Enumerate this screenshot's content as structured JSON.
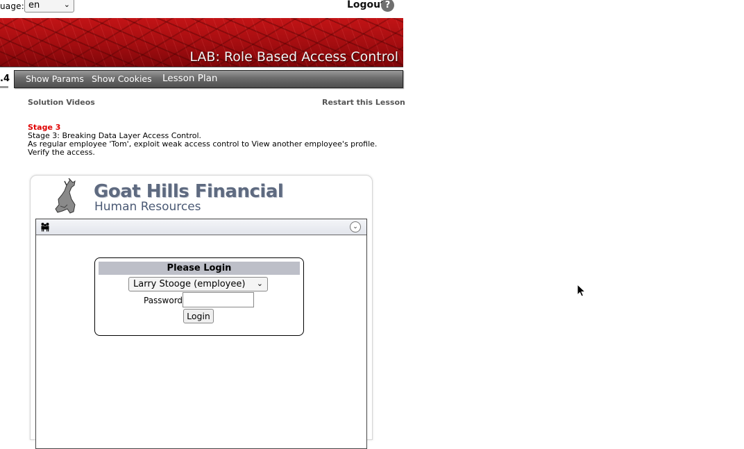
{
  "top": {
    "language_label": "uage:",
    "language_value": "en",
    "logout_label": "Logout",
    "help_label": "?"
  },
  "banner": {
    "title": "LAB: Role Based Access Control"
  },
  "tab_stub": ".4",
  "nav": {
    "items": [
      "Show Params",
      "Show Cookies",
      "Lesson Plan"
    ]
  },
  "links": {
    "solution_videos": "Solution Videos",
    "restart_lesson": "Restart this Lesson"
  },
  "stage": {
    "title": "Stage 3",
    "description": "Stage 3: Breaking Data Layer Access Control.",
    "instructions": "As regular employee 'Tom', exploit weak access control to View another employee's profile. Verify the access."
  },
  "app": {
    "logo_line1": "Goat Hills Financial",
    "logo_line2": "Human Resources",
    "login": {
      "title": "Please Login",
      "employee_selected": "Larry Stooge (employee)",
      "password_label": "Password",
      "password_value": "",
      "login_button": "Login"
    }
  }
}
